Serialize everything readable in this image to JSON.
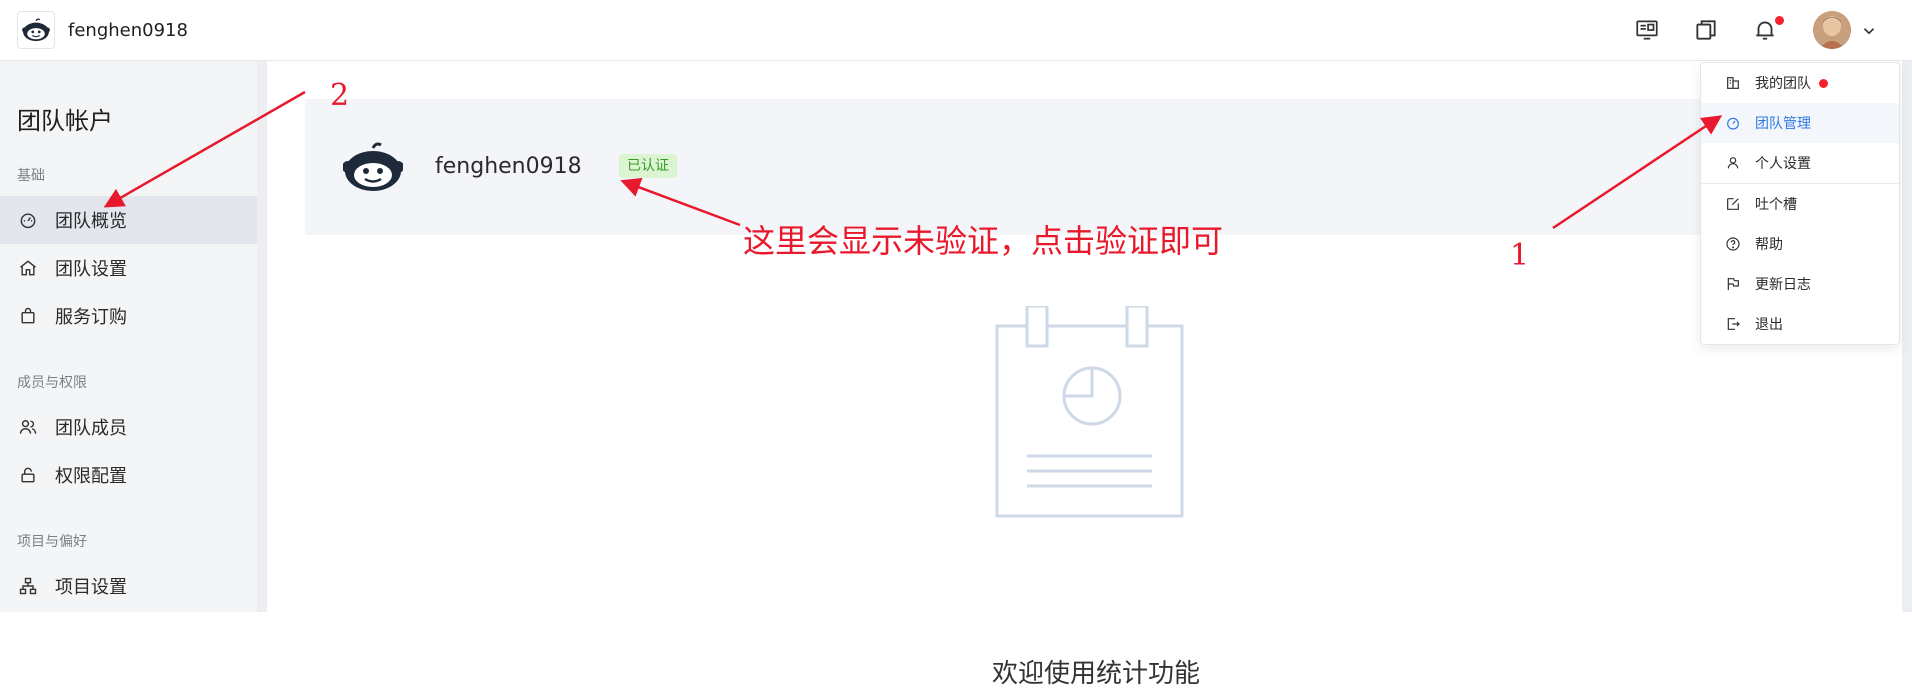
{
  "header": {
    "team_name": "fenghen0918"
  },
  "sidebar": {
    "title": "团队帐户",
    "groups": [
      {
        "label": "基础",
        "items": [
          {
            "label": "团队概览",
            "icon": "dashboard-icon",
            "active": true
          },
          {
            "label": "团队设置",
            "icon": "home-icon"
          },
          {
            "label": "服务订购",
            "icon": "shopping-bag-icon"
          }
        ]
      },
      {
        "label": "成员与权限",
        "items": [
          {
            "label": "团队成员",
            "icon": "users-icon"
          },
          {
            "label": "权限配置",
            "icon": "lock-icon"
          }
        ]
      },
      {
        "label": "项目与偏好",
        "items": [
          {
            "label": "项目设置",
            "icon": "sitemap-icon"
          }
        ]
      }
    ]
  },
  "main": {
    "team_name": "fenghen0918",
    "verified_label": "已认证",
    "welcome_text": "欢迎使用统计功能"
  },
  "dropdown": {
    "items": [
      {
        "label": "我的团队",
        "icon": "building-icon",
        "has_dot": true
      },
      {
        "label": "团队管理",
        "icon": "dashboard-icon",
        "active": true
      },
      {
        "label": "个人设置",
        "icon": "user-icon"
      },
      {
        "label": "吐个槽",
        "icon": "edit-icon"
      },
      {
        "label": "帮助",
        "icon": "help-icon"
      },
      {
        "label": "更新日志",
        "icon": "flag-icon"
      },
      {
        "label": "退出",
        "icon": "logout-icon"
      }
    ]
  },
  "annotations": {
    "label_1": "1",
    "label_2": "2",
    "note": "这里会显示未验证，点击验证即可"
  },
  "colors": {
    "accent": "#2f7ae6",
    "annotation_red": "#e8192c",
    "verified_bg": "#dbf5d3",
    "verified_text": "#3c9a2c"
  }
}
